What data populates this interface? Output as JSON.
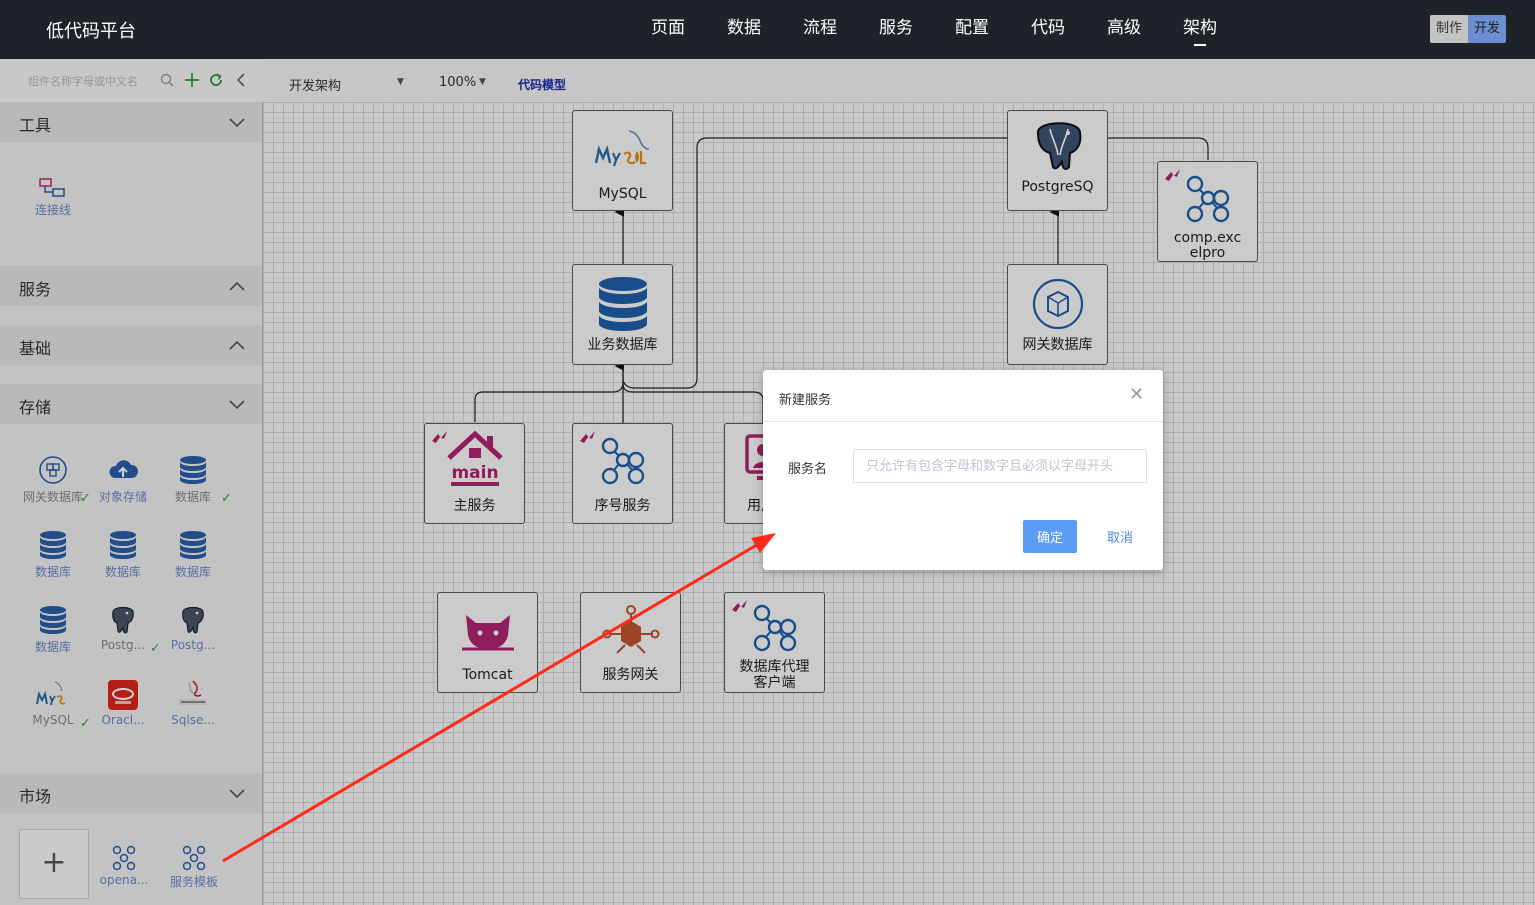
{
  "app": {
    "title": "低代码平台"
  },
  "nav": {
    "items": [
      "页面",
      "数据",
      "流程",
      "服务",
      "配置",
      "代码",
      "高级",
      "架构"
    ],
    "active_index": 7
  },
  "mode_toggle": {
    "make_label": "制作",
    "dev_label": "开发"
  },
  "sidebar": {
    "search_placeholder": "组件名称字母或中文名",
    "sections": {
      "tools": {
        "title": "工具",
        "items": [
          {
            "label": "连接线"
          }
        ]
      },
      "service": {
        "title": "服务"
      },
      "basic": {
        "title": "基础"
      },
      "storage": {
        "title": "存储",
        "items": [
          {
            "label": "网关数据库"
          },
          {
            "label": "对象存储"
          },
          {
            "label": "数据库"
          },
          {
            "label": "数据库"
          },
          {
            "label": "数据库"
          },
          {
            "label": "数据库"
          },
          {
            "label": "数据库"
          },
          {
            "label": "Postg..."
          },
          {
            "label": "Postg..."
          },
          {
            "label": "MySQL"
          },
          {
            "label": "Oracl..."
          },
          {
            "label": "Sqlse..."
          }
        ]
      },
      "market": {
        "title": "市场",
        "items": [
          {
            "label": "opena..."
          },
          {
            "label": "服务模板"
          }
        ]
      }
    }
  },
  "toolbar": {
    "architecture_select": "开发架构",
    "zoom_select": "100%",
    "code_model_link": "代码模型"
  },
  "canvas": {
    "nodes": {
      "mysql": "MySQL",
      "business_db": "业务数据库",
      "postgresql": "PostgreSQ",
      "comp_line1": "comp.exc",
      "comp_line2": "elpro",
      "gateway_db": "网关数据库",
      "main_service": "主服务",
      "serial_service": "序号服务",
      "user_partial": "用户",
      "tomcat": "Tomcat",
      "service_gateway": "服务网关",
      "db_proxy_line1": "数据库代理",
      "db_proxy_line2": "客户端"
    }
  },
  "modal": {
    "title": "新建服务",
    "field_label": "服务名",
    "field_placeholder": "只允许有包含字母和数字且必须以字母开头",
    "field_value": "",
    "ok_label": "确定",
    "cancel_label": "取消"
  },
  "colors": {
    "topbar": "#1e2329",
    "accent": "#5b9cf3",
    "icon_blue": "#1e5fa8",
    "icon_magenta": "#b0246f",
    "arrow_red": "#ff2a1a"
  }
}
